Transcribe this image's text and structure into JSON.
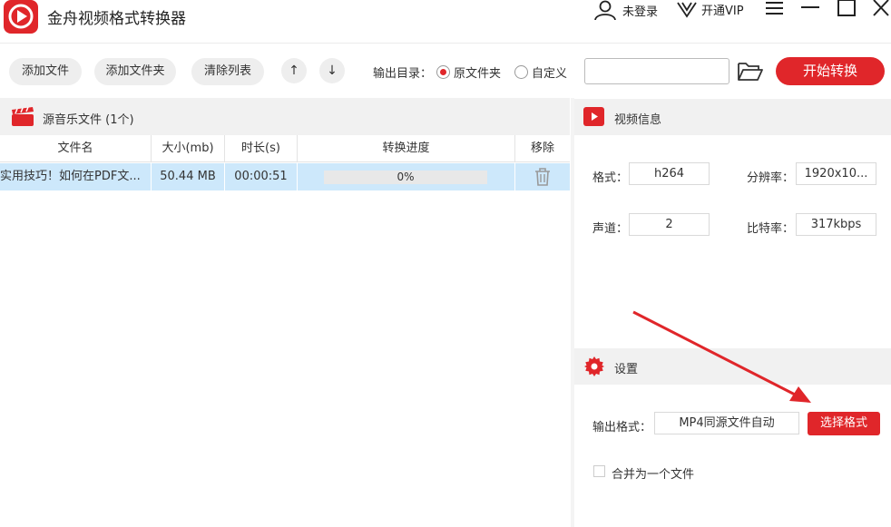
{
  "app": {
    "title": "金舟视频格式转换器",
    "accent_color": "#e0262a",
    "logo_icon": "app-logo-icon"
  },
  "titlebar": {
    "login_label": "未登录",
    "vip_label": "开通VIP",
    "menu_icon": "menu-icon",
    "minimize_icon": "minimize-icon",
    "maximize_icon": "maximize-icon",
    "close_icon": "close-icon"
  },
  "toolbar": {
    "add_file": "添加文件",
    "add_folder": "添加文件夹",
    "clear_list": "清除列表",
    "move_up": "↑",
    "move_down": "↓",
    "output_dir_label": "输出目录：",
    "radio_source": "原文件夹",
    "radio_custom": "自定义",
    "radio_selected": "原文件夹",
    "path_value": "",
    "folder_icon": "folder-open-icon",
    "start_button": "开始转换"
  },
  "file_list": {
    "header_title": "源音乐文件 (1个)",
    "columns": [
      "文件名",
      "大小(mb)",
      "时长(s)",
      "转换进度",
      "移除"
    ],
    "rows": [
      {
        "name": "实用技巧！如何在PDF文...",
        "size": "50.44 MB",
        "duration": "00:00:51",
        "progress_text": "0%",
        "progress": 0,
        "remove_icon": "trash-icon"
      }
    ]
  },
  "video_info": {
    "header_title": "视频信息",
    "format_label": "格式：",
    "format_value": "h264",
    "resolution_label": "分辨率：",
    "resolution_value": "1920x10...",
    "channel_label": "声道：",
    "channel_value": "2",
    "bitrate_label": "比特率：",
    "bitrate_value": "317kbps"
  },
  "settings": {
    "header_title": "设置",
    "output_format_label": "输出格式：",
    "output_format_value": "MP4同源文件自动",
    "select_format_button": "选择格式",
    "merge_label": "合并为一个文件",
    "merge_checked": false
  }
}
